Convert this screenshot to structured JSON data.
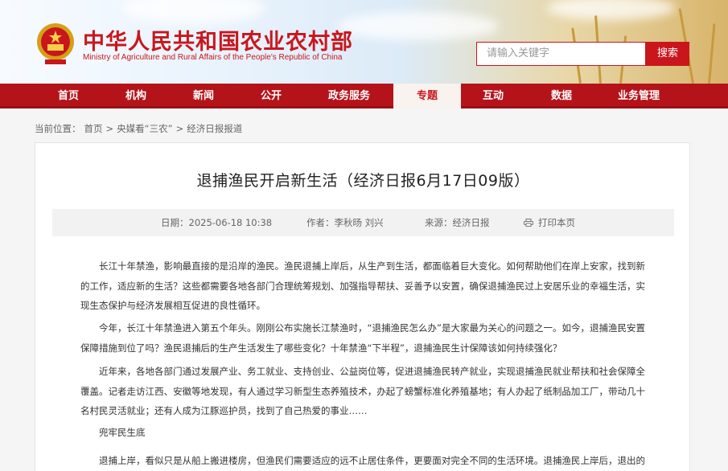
{
  "header": {
    "site_title": "中华人民共和国农业农村部",
    "site_subtitle": "Ministry of Agriculture and Rural Affairs of the People's Republic of China",
    "search": {
      "placeholder": "请输入关键字",
      "button_label": "搜索"
    }
  },
  "nav": {
    "items": [
      {
        "label": "首页"
      },
      {
        "label": "机构"
      },
      {
        "label": "新闻"
      },
      {
        "label": "公开"
      },
      {
        "label": "政务服务"
      },
      {
        "label": "专题",
        "active": true
      },
      {
        "label": "互动"
      },
      {
        "label": "数据"
      },
      {
        "label": "业务管理"
      }
    ]
  },
  "breadcrumb": {
    "prefix": "当前位置：",
    "items": [
      "首页",
      ">",
      "央媒看“三农”",
      ">",
      "经济日报报道"
    ]
  },
  "article": {
    "title": "退捕渔民开启新生活（经济日报6月17日09版）",
    "meta": {
      "date": "日期：2025-06-18 10:38",
      "author": "作者：李秋旸 刘兴",
      "source": "来源：经济日报",
      "print_label": "打印本页"
    },
    "paragraphs": [
      "长江十年禁渔，影响最直接的是沿岸的渔民。渔民退捕上岸后，从生产到生活，都面临着巨大变化。如何帮助他们在岸上安家，找到新的工作，适应新的生活？这些都需要各地各部门合理统筹规划、加强指导帮扶、妥善予以安置，确保退捕渔民过上安居乐业的幸福生活，实现生态保护与经济发展相互促进的良性循环。",
      "今年，长江十年禁渔进入第五个年头。刚刚公布实施长江禁渔时，“退捕渔民怎么办”是大家最为关心的问题之一。如今，退捕渔民安置保障措施到位了吗？渔民退捕后的生产生活发生了哪些变化？十年禁渔“下半程”，退捕渔民生计保障该如何持续强化？",
      "近年来，各地各部门通过发展产业、务工就业、支持创业、公益岗位等，促进退捕渔民转产就业，实现退捕渔民就业帮扶和社会保障全覆盖。记者走访江西、安徽等地发现，有人通过学习新型生态养殖技术，办起了螃蟹标准化养殖基地；有人办起了纸制品加工厂，带动几十名村民灵活就业；还有人成为江豚巡护员，找到了自己热爱的事业……",
      "兜牢民生底",
      "退捕上岸，看似只是从船上搬进楼房，但渔民们需要适应的远不止居住条件，更要面对完全不同的生活环境。退捕渔民上岸后，退出的是旧身"
    ]
  }
}
